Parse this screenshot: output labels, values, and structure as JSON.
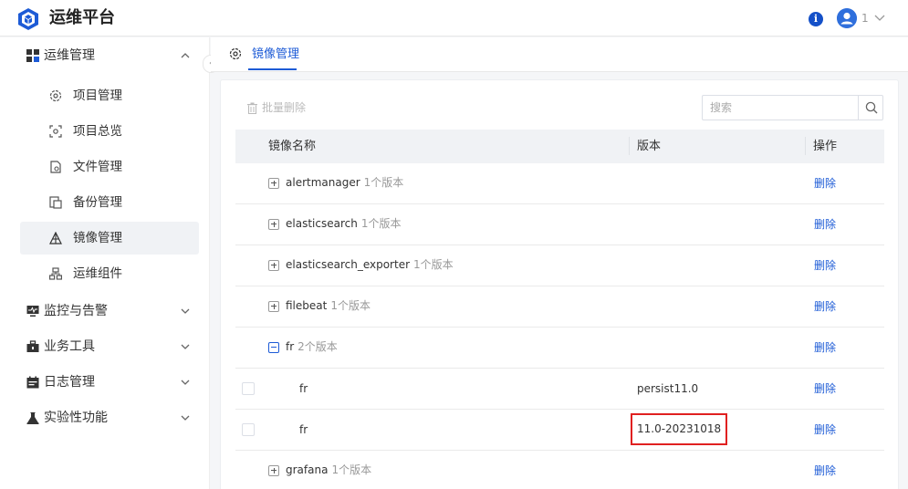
{
  "header": {
    "title": "运维平台",
    "user_label": "1",
    "logo_icon": "cube-logo-icon",
    "info_icon": "info-icon",
    "colors": {
      "brand": "#1d5bd6",
      "highlight": "#e02020"
    }
  },
  "sidebar": {
    "collapse_glyph": "‹",
    "groups": [
      {
        "label": "运维管理",
        "icon": "grid-icon",
        "expanded": true
      },
      {
        "label": "监控与告警",
        "icon": "monitor-icon",
        "expanded": false
      },
      {
        "label": "业务工具",
        "icon": "toolbox-icon",
        "expanded": false
      },
      {
        "label": "日志管理",
        "icon": "calendar-icon",
        "expanded": false
      },
      {
        "label": "实验性功能",
        "icon": "flask-icon",
        "expanded": false
      }
    ],
    "items": [
      {
        "label": "项目管理",
        "icon": "gear-icon"
      },
      {
        "label": "项目总览",
        "icon": "scan-icon"
      },
      {
        "label": "文件管理",
        "icon": "file-settings-icon"
      },
      {
        "label": "备份管理",
        "icon": "backup-icon"
      },
      {
        "label": "镜像管理",
        "icon": "image-icon",
        "active": true
      },
      {
        "label": "运维组件",
        "icon": "components-icon"
      }
    ]
  },
  "tab": {
    "label": "镜像管理"
  },
  "toolbar": {
    "batch_delete": "批量删除",
    "search_placeholder": "搜索"
  },
  "table": {
    "columns": [
      "镜像名称",
      "版本",
      "操作"
    ],
    "rows": [
      {
        "name": "alertmanager",
        "count": "1个版本",
        "op": "删除"
      },
      {
        "name": "elasticsearch",
        "count": "1个版本",
        "op": "删除"
      },
      {
        "name": "elasticsearch_exporter",
        "count": "1个版本",
        "op": "删除"
      },
      {
        "name": "filebeat",
        "count": "1个版本",
        "op": "删除"
      },
      {
        "name": "fr",
        "count": "2个版本",
        "op": "删除",
        "expanded": true
      },
      {
        "name": "fr",
        "version": "persist11.0",
        "op": "删除",
        "child": true
      },
      {
        "name": "fr",
        "version": "11.0-20231018",
        "op": "删除",
        "child": true,
        "highlighted": true
      },
      {
        "name": "grafana",
        "count": "1个版本",
        "op": "删除"
      }
    ]
  }
}
